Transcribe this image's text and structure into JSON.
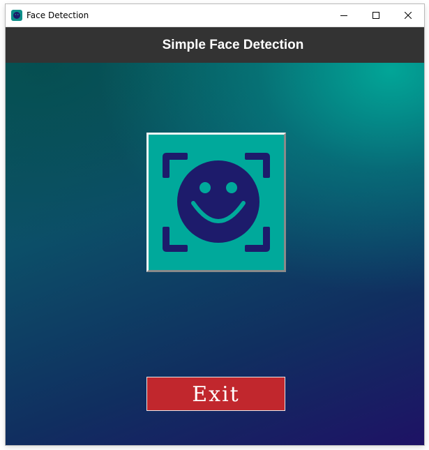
{
  "window": {
    "title": "Face Detection",
    "icon": "face-app-icon",
    "controls": [
      "minimize-icon",
      "maximize-icon",
      "close-icon"
    ]
  },
  "header": {
    "title": "Simple Face Detection",
    "background": "#333333"
  },
  "main": {
    "face_button_icon": "face-scan-smiley-icon",
    "face_button_color": "#00a99b",
    "icon_color": "#1d1b6b",
    "exit_label": "Exit",
    "exit_color": "#c1272d"
  }
}
